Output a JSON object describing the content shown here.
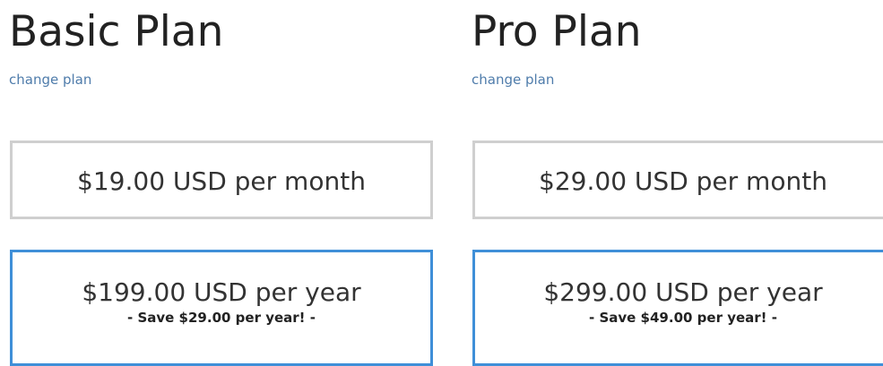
{
  "plans": [
    {
      "title": "Basic Plan",
      "change_label": "change plan",
      "monthly": {
        "price": "$19.00 USD per month"
      },
      "yearly": {
        "price": "$199.00 USD per year",
        "savings": "- Save $29.00 per year! -"
      }
    },
    {
      "title": "Pro Plan",
      "change_label": "change plan",
      "monthly": {
        "price": "$29.00 USD per month"
      },
      "yearly": {
        "price": "$299.00 USD per year",
        "savings": "- Save $49.00 per year! -"
      }
    }
  ],
  "colors": {
    "link": "#4f7cab",
    "selected_border": "#3f8fd8",
    "default_border": "#cfcfcf"
  }
}
